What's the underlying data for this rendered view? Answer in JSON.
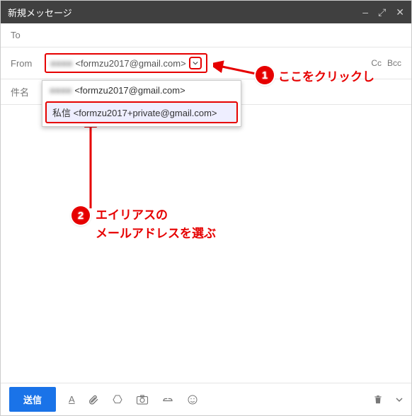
{
  "header": {
    "title": "新規メッセージ"
  },
  "fields": {
    "to_label": "To",
    "from_label": "From",
    "subject_label": "件名",
    "cc_label": "Cc",
    "bcc_label": "Bcc"
  },
  "from": {
    "display_name_masked": "■■■■",
    "email": "<formzu2017@gmail.com>"
  },
  "dropdown": {
    "option1_name_masked": "■■■■",
    "option1_email": "<formzu2017@gmail.com>",
    "option2_label": "私信 <formzu2017+private@gmail.com>"
  },
  "annotations": {
    "step1_num": "1",
    "step1_text": "ここをクリックし",
    "step2_num": "2",
    "step2_text": "エイリアスの\nメールアドレスを選ぶ"
  },
  "toolbar": {
    "send": "送信"
  }
}
